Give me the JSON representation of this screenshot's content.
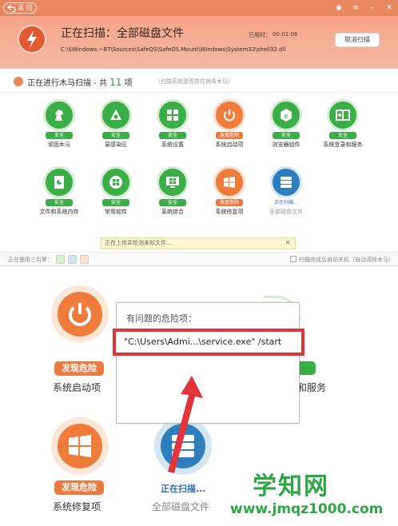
{
  "titlebar": {
    "back_label": "返 回"
  },
  "header": {
    "title": "正在扫描：全部磁盘文件",
    "path": "C:\\$Windows.~BT\\Sources\\SafeOS\\SafeOS.Mount\\Windows\\System32\\shell32.dll",
    "elapsed_label": "已用时：",
    "elapsed_value": "00:01:06",
    "cancel_label": "取消扫描"
  },
  "subheader": {
    "title_prefix": "正在进行木马扫描 - 共",
    "count": "11",
    "title_suffix": "项",
    "note": "（扫描系统是否存在病毒木马）"
  },
  "items": [
    {
      "label": "顽固木马",
      "status": "安全",
      "state": "safe",
      "icon": "horse-icon"
    },
    {
      "label": "易感染区",
      "status": "安全",
      "state": "safe",
      "icon": "nodes-icon"
    },
    {
      "label": "系统设置",
      "status": "安全",
      "state": "safe",
      "icon": "settings-icon"
    },
    {
      "label": "系统启动项",
      "status": "发现危险",
      "state": "danger",
      "icon": "power-icon"
    },
    {
      "label": "浏览器组件",
      "status": "安全",
      "state": "safe",
      "icon": "browser-icon"
    },
    {
      "label": "系统登录和服务",
      "status": "安全",
      "state": "safe",
      "icon": "login-icon"
    },
    {
      "label": "文件和系统内存",
      "status": "安全",
      "state": "safe",
      "icon": "memory-icon"
    },
    {
      "label": "常用软件",
      "status": "安全",
      "state": "safe",
      "icon": "apps-icon"
    },
    {
      "label": "系统综合",
      "status": "安全",
      "state": "safe",
      "icon": "windows-icon"
    },
    {
      "label": "系统修复项",
      "status": "发现危险",
      "state": "danger",
      "icon": "repair-icon"
    },
    {
      "label": "全部磁盘文件",
      "status": "正在扫描...",
      "state": "scanning",
      "icon": "disk-icon"
    }
  ],
  "notice": {
    "text": "正在上传并检测未知文件...",
    "close": "×"
  },
  "statusbar": {
    "label": "正在使用三引擎：",
    "checkbox_label": "扫描完成后自动关机（自动清除木马）"
  },
  "zoom": {
    "startup_status": "发现危险",
    "startup_label": "系统启动项",
    "repair_status": "发现危险",
    "repair_label": "系统修复项",
    "disk_status": "正在扫描...",
    "disk_label": "全部磁盘文件",
    "service_label_partial": "和服务"
  },
  "popup": {
    "title": "有问题的危险项：",
    "item": "\"C:\\Users\\Admi...\\service.exe\" /start"
  },
  "watermark": {
    "top": "学知网",
    "bottom": "www.jmqz1000.com"
  },
  "colors": {
    "accent_orange": "#ea7a3f",
    "safe_green": "#3cae47",
    "highlight_red": "#e0353a",
    "scan_blue": "#2f7fbf"
  }
}
